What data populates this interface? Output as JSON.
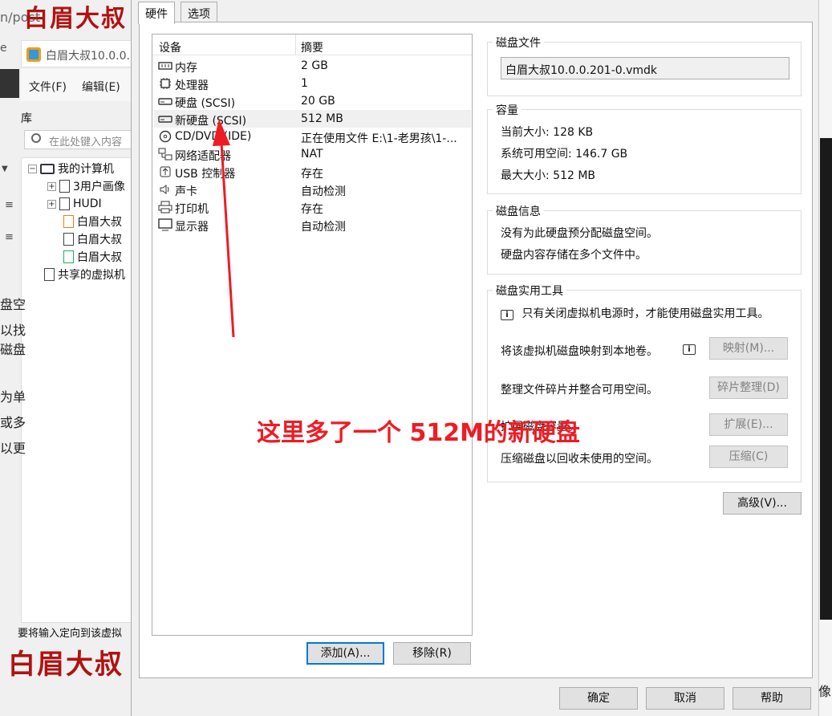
{
  "background": {
    "watermark_top": "白眉大叔",
    "watermark_bottom": "白眉大叔",
    "url_fragment": "n/post",
    "close_glyph": "e",
    "window_title": "白眉大叔10.0.0.",
    "menu": {
      "file": "文件(F)",
      "edit": "编辑(E)"
    },
    "library_label": "库",
    "search_placeholder": "在此处键入内容",
    "tree": [
      {
        "label": "我的计算机"
      },
      {
        "label": "3用户画像"
      },
      {
        "label": "HUDI"
      },
      {
        "label": "白眉大叔"
      },
      {
        "label": "白眉大叔"
      },
      {
        "label": "白眉大叔"
      },
      {
        "label": "共享的虚拟机"
      }
    ],
    "side_fragments": [
      "盘空",
      "以找",
      "磁盘",
      "为单",
      "或多",
      "以更"
    ],
    "status_text": "要将输入定向到该虚拟",
    "right_fragment": "像"
  },
  "dialog": {
    "tabs": [
      {
        "label": "硬件"
      },
      {
        "label": "选项"
      }
    ],
    "device_list": {
      "col_device": "设备",
      "col_summary": "摘要",
      "rows": [
        {
          "name": "内存",
          "summary": "2 GB",
          "icon": "memory-icon"
        },
        {
          "name": "处理器",
          "summary": "1",
          "icon": "cpu-icon"
        },
        {
          "name": "硬盘 (SCSI)",
          "summary": "20 GB",
          "icon": "hard-disk-icon"
        },
        {
          "name": "新硬盘 (SCSI)",
          "summary": "512 MB",
          "icon": "hard-disk-icon"
        },
        {
          "name": "CD/DVD (IDE)",
          "summary": "正在使用文件 E:\\1-老男孩\\1-...",
          "icon": "cd-dvd-icon"
        },
        {
          "name": "网络适配器",
          "summary": "NAT",
          "icon": "network-adapter-icon"
        },
        {
          "name": "USB 控制器",
          "summary": "存在",
          "icon": "usb-icon"
        },
        {
          "name": "声卡",
          "summary": "自动检测",
          "icon": "sound-card-icon"
        },
        {
          "name": "打印机",
          "summary": "存在",
          "icon": "printer-icon"
        },
        {
          "name": "显示器",
          "summary": "自动检测",
          "icon": "display-icon"
        }
      ],
      "selected_index": 3
    },
    "buttons": {
      "add": "添加(A)...",
      "remove": "移除(R)",
      "ok": "确定",
      "cancel": "取消",
      "help": "帮助",
      "advanced": "高级(V)..."
    },
    "disk_file": {
      "title": "磁盘文件",
      "path": "白眉大叔10.0.0.201-0.vmdk"
    },
    "capacity": {
      "title": "容量",
      "current": "当前大小: 128 KB",
      "available": "系统可用空间: 146.7 GB",
      "max": "最大大小: 512 MB"
    },
    "disk_info": {
      "title": "磁盘信息",
      "line1": "没有为此硬盘预分配磁盘空间。",
      "line2": "硬盘内容存储在多个文件中。"
    },
    "utilities": {
      "title": "磁盘实用工具",
      "note": "只有关闭虚拟机电源时，才能使用磁盘实用工具。",
      "map_text": "将该虚拟机磁盘映射到本地卷。",
      "map_btn": "映射(M)...",
      "defrag_text": "整理文件碎片并整合可用空间。",
      "defrag_btn": "碎片整理(D)",
      "expand_text": "扩展磁盘容量。",
      "expand_btn": "扩展(E)...",
      "compact_text": "压缩磁盘以回收未使用的空间。",
      "compact_btn": "压缩(C)"
    }
  },
  "annotation": {
    "text": "这里多了一个 512M的新硬盘",
    "color": "#ee1c24"
  }
}
